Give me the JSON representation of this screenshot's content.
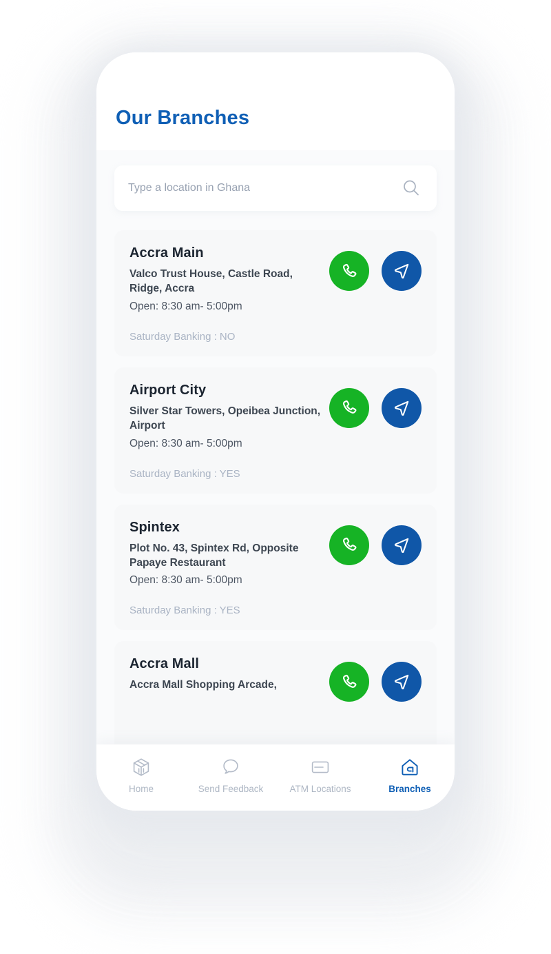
{
  "header": {
    "title": "Our Branches"
  },
  "search": {
    "placeholder": "Type a location in Ghana",
    "value": "",
    "icon": "search-icon"
  },
  "colors": {
    "brand_blue": "#0f5fb5",
    "call_green": "#16b325",
    "directions_blue": "#1057a8",
    "card_bg": "#f7f8f9",
    "muted_text": "#aab4c4"
  },
  "branches": [
    {
      "name": "Accra Main",
      "address": "Valco Trust House, Castle Road, Ridge, Accra",
      "hours": "Open: 8:30 am- 5:00pm",
      "saturday_banking": "Saturday Banking : NO",
      "call_icon": "phone-icon",
      "directions_icon": "navigation-arrow-icon"
    },
    {
      "name": "Airport City",
      "address": "Silver Star Towers, Opeibea Junction, Airport",
      "hours": "Open: 8:30 am- 5:00pm",
      "saturday_banking": "Saturday Banking : YES",
      "call_icon": "phone-icon",
      "directions_icon": "navigation-arrow-icon"
    },
    {
      "name": "Spintex",
      "address": "Plot No. 43, Spintex Rd, Opposite Papaye Restaurant",
      "hours": "Open: 8:30 am- 5:00pm",
      "saturday_banking": "Saturday Banking : YES",
      "call_icon": "phone-icon",
      "directions_icon": "navigation-arrow-icon"
    },
    {
      "name": "Accra Mall",
      "address": "Accra Mall Shopping Arcade,",
      "hours": "",
      "saturday_banking": "",
      "call_icon": "phone-icon",
      "directions_icon": "navigation-arrow-icon"
    }
  ],
  "bottom_nav": {
    "items": [
      {
        "label": "Home",
        "icon": "cube-box-icon",
        "active": false
      },
      {
        "label": "Send Feedback",
        "icon": "speech-bubble-icon",
        "active": false
      },
      {
        "label": "ATM Locations",
        "icon": "credit-card-icon",
        "active": false
      },
      {
        "label": "Branches",
        "icon": "bank-house-icon",
        "active": true
      }
    ]
  }
}
